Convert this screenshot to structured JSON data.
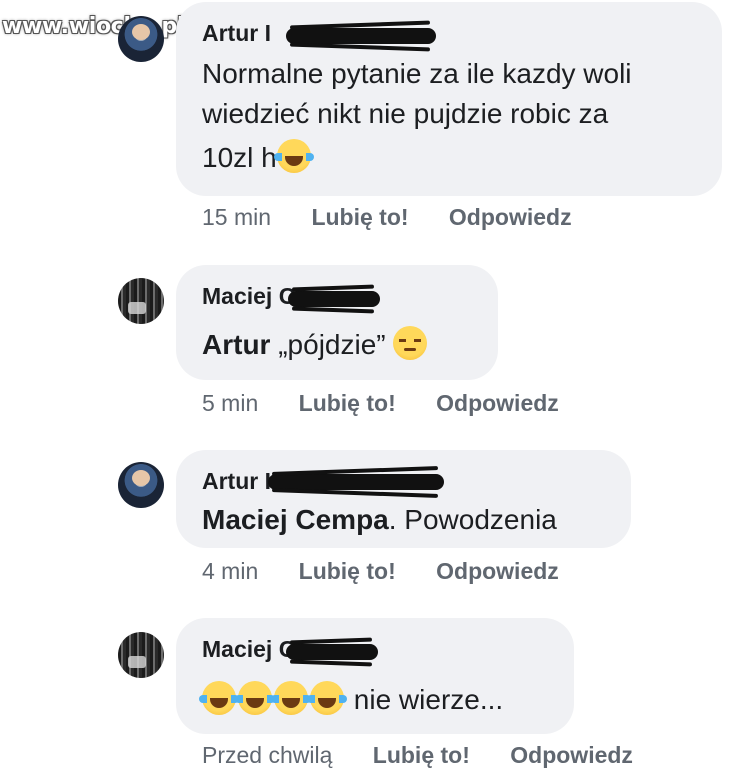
{
  "watermark": "www.wiocha.pl",
  "comments": [
    {
      "author": "Artur I",
      "text": "Normalne pytanie za ile kazdy woli wiedzieć nikt nie pujdzie robic za 10zl h",
      "line1": "Normalne pytanie za ile kazdy woli",
      "line2": "wiedzieć nikt nie pujdzie robic za",
      "line3": "10zl h",
      "time": "15 min",
      "like": "Lubię to!",
      "reply": "Odpowiedz"
    },
    {
      "author": "Maciej C",
      "mention": "Artur",
      "text": "„pójdzie”",
      "time": "5 min",
      "like": "Lubię to!",
      "reply": "Odpowiedz"
    },
    {
      "author": "Artur I",
      "mention": "Maciej Cempa",
      "text": ". Powodzenia",
      "time": "4 min",
      "like": "Lubię to!",
      "reply": "Odpowiedz"
    },
    {
      "author": "Maciej C",
      "text": "nie wierze...",
      "time": "Przed chwilą",
      "like": "Lubię to!",
      "reply": "Odpowiedz"
    }
  ],
  "icons": {
    "laugh": "face-with-tears-of-joy-icon",
    "pensive": "pensive-face-icon"
  }
}
